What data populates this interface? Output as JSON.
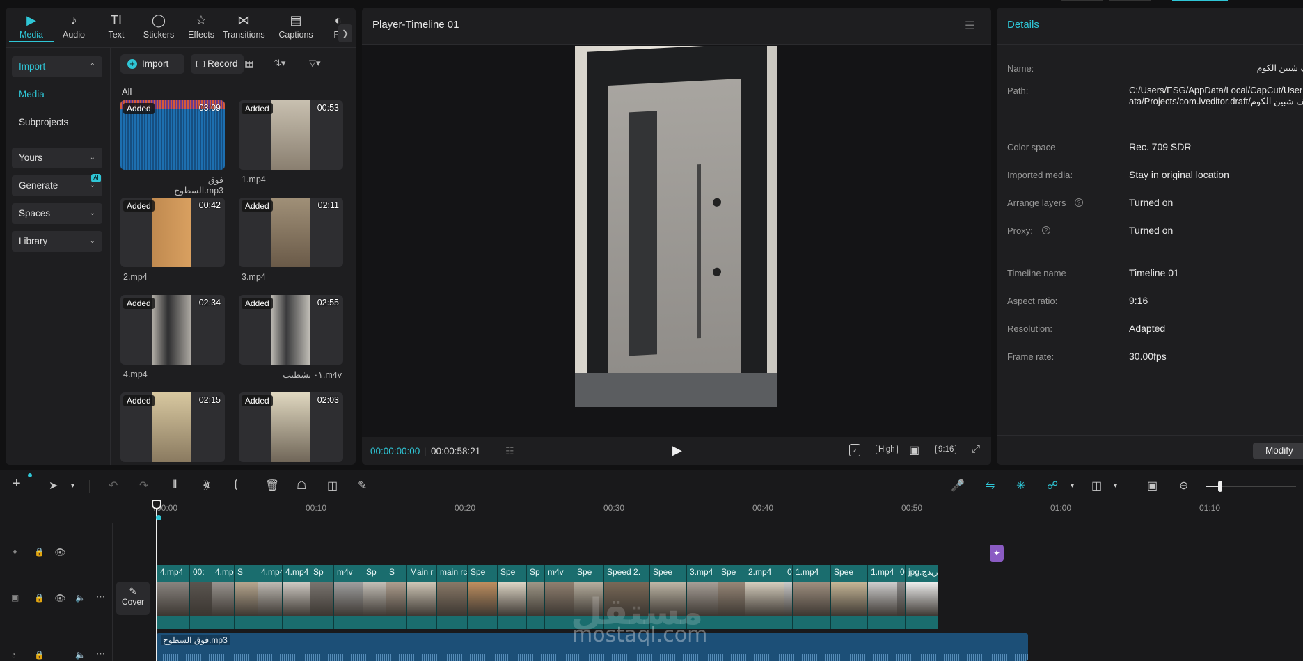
{
  "tabs": [
    {
      "label": "Media",
      "icon": "media-icon"
    },
    {
      "label": "Audio",
      "icon": "audio-icon"
    },
    {
      "label": "Text",
      "icon": "text-icon"
    },
    {
      "label": "Stickers",
      "icon": "stickers-icon"
    },
    {
      "label": "Effects",
      "icon": "effects-icon"
    },
    {
      "label": "Transitions",
      "icon": "transitions-icon"
    },
    {
      "label": "Captions",
      "icon": "captions-icon"
    },
    {
      "label": "Fil",
      "icon": "filters-icon"
    }
  ],
  "sidebar": {
    "import": "Import",
    "media": "Media",
    "subprojects": "Subprojects",
    "yours": "Yours",
    "generate": "Generate",
    "generate_badge": "AI",
    "spaces": "Spaces",
    "library": "Library"
  },
  "media_toolbar": {
    "import_button": "Import",
    "record_button": "Record",
    "filter_all": "All"
  },
  "media_items": [
    {
      "badge": "Added",
      "duration": "03:09",
      "name": "فوق السطوح.mp3"
    },
    {
      "badge": "Added",
      "duration": "00:53",
      "name": "1.mp4"
    },
    {
      "badge": "Added",
      "duration": "00:42",
      "name": "2.mp4"
    },
    {
      "badge": "Added",
      "duration": "02:11",
      "name": "3.mp4"
    },
    {
      "badge": "Added",
      "duration": "02:34",
      "name": "4.mp4"
    },
    {
      "badge": "Added",
      "duration": "02:55",
      "name": "٠١ تشطيب.m4v"
    },
    {
      "badge": "Added",
      "duration": "02:15",
      "name": ""
    },
    {
      "badge": "Added",
      "duration": "02:03",
      "name": ""
    }
  ],
  "player": {
    "title": "Player-Timeline 01",
    "current_time": "00:00:00:00",
    "total_time": "00:00:58:21",
    "quality": "High",
    "ratio": "9:16"
  },
  "details": {
    "title": "Details",
    "rows": [
      {
        "label": "Name:",
        "value": "لايف شبين الكوم"
      },
      {
        "label": "Path:",
        "value": "C:/Users/ESG/AppData/Local/CapCut/User Data/Projects/com.lveditor.draft/لايف شبين الكوم"
      },
      {
        "label": "Color space",
        "value": "Rec. 709 SDR"
      },
      {
        "label": "Imported media:",
        "value": "Stay in original location"
      },
      {
        "label": "Arrange layers",
        "value": "Turned on"
      },
      {
        "label": "Proxy:",
        "value": "Turned on"
      },
      {
        "label": "Timeline name",
        "value": "Timeline 01"
      },
      {
        "label": "Aspect ratio:",
        "value": "9:16"
      },
      {
        "label": "Resolution:",
        "value": "Adapted"
      },
      {
        "label": "Frame rate:",
        "value": "30.00fps"
      }
    ],
    "modify_button": "Modify"
  },
  "timeline": {
    "ruler": [
      "00:00",
      "00:10",
      "00:20",
      "00:30",
      "00:40",
      "00:50",
      "01:00",
      "01:10"
    ],
    "cover_label": "Cover",
    "audio_clip_label": "فوق السطوح.mp3",
    "video_clips": [
      "4.mp4",
      "00:",
      "4.mp",
      "S",
      "4.mp4",
      "4.mp4",
      "Sp",
      "m4v",
      "Sp",
      "S",
      "Main r",
      "main rc",
      "Spe",
      "Spe",
      "Sp",
      "m4v",
      "Spe",
      "Speed 2.",
      "Spee",
      "3.mp4",
      "Spe",
      "2.mp4",
      "0(",
      "1.mp4",
      "Spee",
      "1.mp4",
      "00:",
      "jpg.ريدج"
    ]
  },
  "watermark": {
    "arabic": "مستقل",
    "latin": "mostaql.com"
  },
  "colors": {
    "accent": "#2fc6d6",
    "clip": "#1a6d6e",
    "audio": "#1c4f77"
  }
}
